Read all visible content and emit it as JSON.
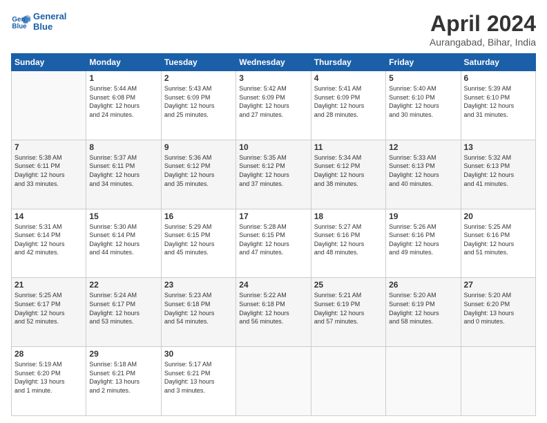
{
  "header": {
    "logo_line1": "General",
    "logo_line2": "Blue",
    "month_year": "April 2024",
    "location": "Aurangabad, Bihar, India"
  },
  "weekdays": [
    "Sunday",
    "Monday",
    "Tuesday",
    "Wednesday",
    "Thursday",
    "Friday",
    "Saturday"
  ],
  "weeks": [
    [
      {
        "day": "",
        "info": ""
      },
      {
        "day": "1",
        "info": "Sunrise: 5:44 AM\nSunset: 6:08 PM\nDaylight: 12 hours\nand 24 minutes."
      },
      {
        "day": "2",
        "info": "Sunrise: 5:43 AM\nSunset: 6:09 PM\nDaylight: 12 hours\nand 25 minutes."
      },
      {
        "day": "3",
        "info": "Sunrise: 5:42 AM\nSunset: 6:09 PM\nDaylight: 12 hours\nand 27 minutes."
      },
      {
        "day": "4",
        "info": "Sunrise: 5:41 AM\nSunset: 6:09 PM\nDaylight: 12 hours\nand 28 minutes."
      },
      {
        "day": "5",
        "info": "Sunrise: 5:40 AM\nSunset: 6:10 PM\nDaylight: 12 hours\nand 30 minutes."
      },
      {
        "day": "6",
        "info": "Sunrise: 5:39 AM\nSunset: 6:10 PM\nDaylight: 12 hours\nand 31 minutes."
      }
    ],
    [
      {
        "day": "7",
        "info": "Sunrise: 5:38 AM\nSunset: 6:11 PM\nDaylight: 12 hours\nand 33 minutes."
      },
      {
        "day": "8",
        "info": "Sunrise: 5:37 AM\nSunset: 6:11 PM\nDaylight: 12 hours\nand 34 minutes."
      },
      {
        "day": "9",
        "info": "Sunrise: 5:36 AM\nSunset: 6:12 PM\nDaylight: 12 hours\nand 35 minutes."
      },
      {
        "day": "10",
        "info": "Sunrise: 5:35 AM\nSunset: 6:12 PM\nDaylight: 12 hours\nand 37 minutes."
      },
      {
        "day": "11",
        "info": "Sunrise: 5:34 AM\nSunset: 6:12 PM\nDaylight: 12 hours\nand 38 minutes."
      },
      {
        "day": "12",
        "info": "Sunrise: 5:33 AM\nSunset: 6:13 PM\nDaylight: 12 hours\nand 40 minutes."
      },
      {
        "day": "13",
        "info": "Sunrise: 5:32 AM\nSunset: 6:13 PM\nDaylight: 12 hours\nand 41 minutes."
      }
    ],
    [
      {
        "day": "14",
        "info": "Sunrise: 5:31 AM\nSunset: 6:14 PM\nDaylight: 12 hours\nand 42 minutes."
      },
      {
        "day": "15",
        "info": "Sunrise: 5:30 AM\nSunset: 6:14 PM\nDaylight: 12 hours\nand 44 minutes."
      },
      {
        "day": "16",
        "info": "Sunrise: 5:29 AM\nSunset: 6:15 PM\nDaylight: 12 hours\nand 45 minutes."
      },
      {
        "day": "17",
        "info": "Sunrise: 5:28 AM\nSunset: 6:15 PM\nDaylight: 12 hours\nand 47 minutes."
      },
      {
        "day": "18",
        "info": "Sunrise: 5:27 AM\nSunset: 6:16 PM\nDaylight: 12 hours\nand 48 minutes."
      },
      {
        "day": "19",
        "info": "Sunrise: 5:26 AM\nSunset: 6:16 PM\nDaylight: 12 hours\nand 49 minutes."
      },
      {
        "day": "20",
        "info": "Sunrise: 5:25 AM\nSunset: 6:16 PM\nDaylight: 12 hours\nand 51 minutes."
      }
    ],
    [
      {
        "day": "21",
        "info": "Sunrise: 5:25 AM\nSunset: 6:17 PM\nDaylight: 12 hours\nand 52 minutes."
      },
      {
        "day": "22",
        "info": "Sunrise: 5:24 AM\nSunset: 6:17 PM\nDaylight: 12 hours\nand 53 minutes."
      },
      {
        "day": "23",
        "info": "Sunrise: 5:23 AM\nSunset: 6:18 PM\nDaylight: 12 hours\nand 54 minutes."
      },
      {
        "day": "24",
        "info": "Sunrise: 5:22 AM\nSunset: 6:18 PM\nDaylight: 12 hours\nand 56 minutes."
      },
      {
        "day": "25",
        "info": "Sunrise: 5:21 AM\nSunset: 6:19 PM\nDaylight: 12 hours\nand 57 minutes."
      },
      {
        "day": "26",
        "info": "Sunrise: 5:20 AM\nSunset: 6:19 PM\nDaylight: 12 hours\nand 58 minutes."
      },
      {
        "day": "27",
        "info": "Sunrise: 5:20 AM\nSunset: 6:20 PM\nDaylight: 13 hours\nand 0 minutes."
      }
    ],
    [
      {
        "day": "28",
        "info": "Sunrise: 5:19 AM\nSunset: 6:20 PM\nDaylight: 13 hours\nand 1 minute."
      },
      {
        "day": "29",
        "info": "Sunrise: 5:18 AM\nSunset: 6:21 PM\nDaylight: 13 hours\nand 2 minutes."
      },
      {
        "day": "30",
        "info": "Sunrise: 5:17 AM\nSunset: 6:21 PM\nDaylight: 13 hours\nand 3 minutes."
      },
      {
        "day": "",
        "info": ""
      },
      {
        "day": "",
        "info": ""
      },
      {
        "day": "",
        "info": ""
      },
      {
        "day": "",
        "info": ""
      }
    ]
  ]
}
